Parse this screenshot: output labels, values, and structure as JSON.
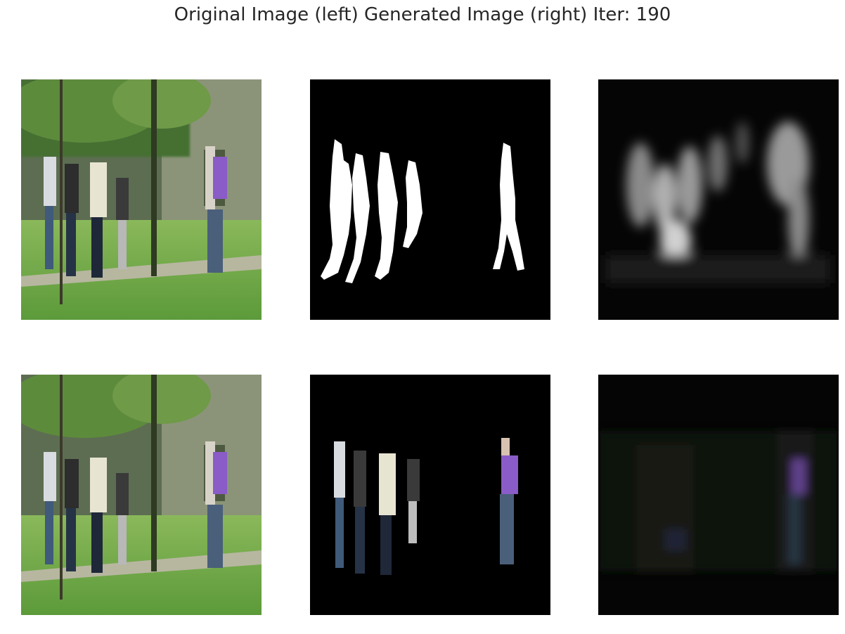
{
  "figure": {
    "title": "Original Image (left) Generated Image (right) Iter: 190"
  },
  "panels": [
    {
      "row": 0,
      "col": 0,
      "content": "park scene photo"
    },
    {
      "row": 0,
      "col": 1,
      "content": "white silhouette mask on black"
    },
    {
      "row": 0,
      "col": 2,
      "content": "blurred grayscale generated mask"
    },
    {
      "row": 1,
      "col": 0,
      "content": "park scene photo"
    },
    {
      "row": 1,
      "col": 1,
      "content": "masked pedestrians on black"
    },
    {
      "row": 1,
      "col": 2,
      "content": "dark generated reconstruction"
    }
  ],
  "colors": {
    "text": "#262626",
    "background": "#ffffff",
    "grass": "#6aa84f",
    "foliage": "#3f6b2a",
    "mask": "#ffffff",
    "purple_shirt": "#8a5cc7"
  }
}
